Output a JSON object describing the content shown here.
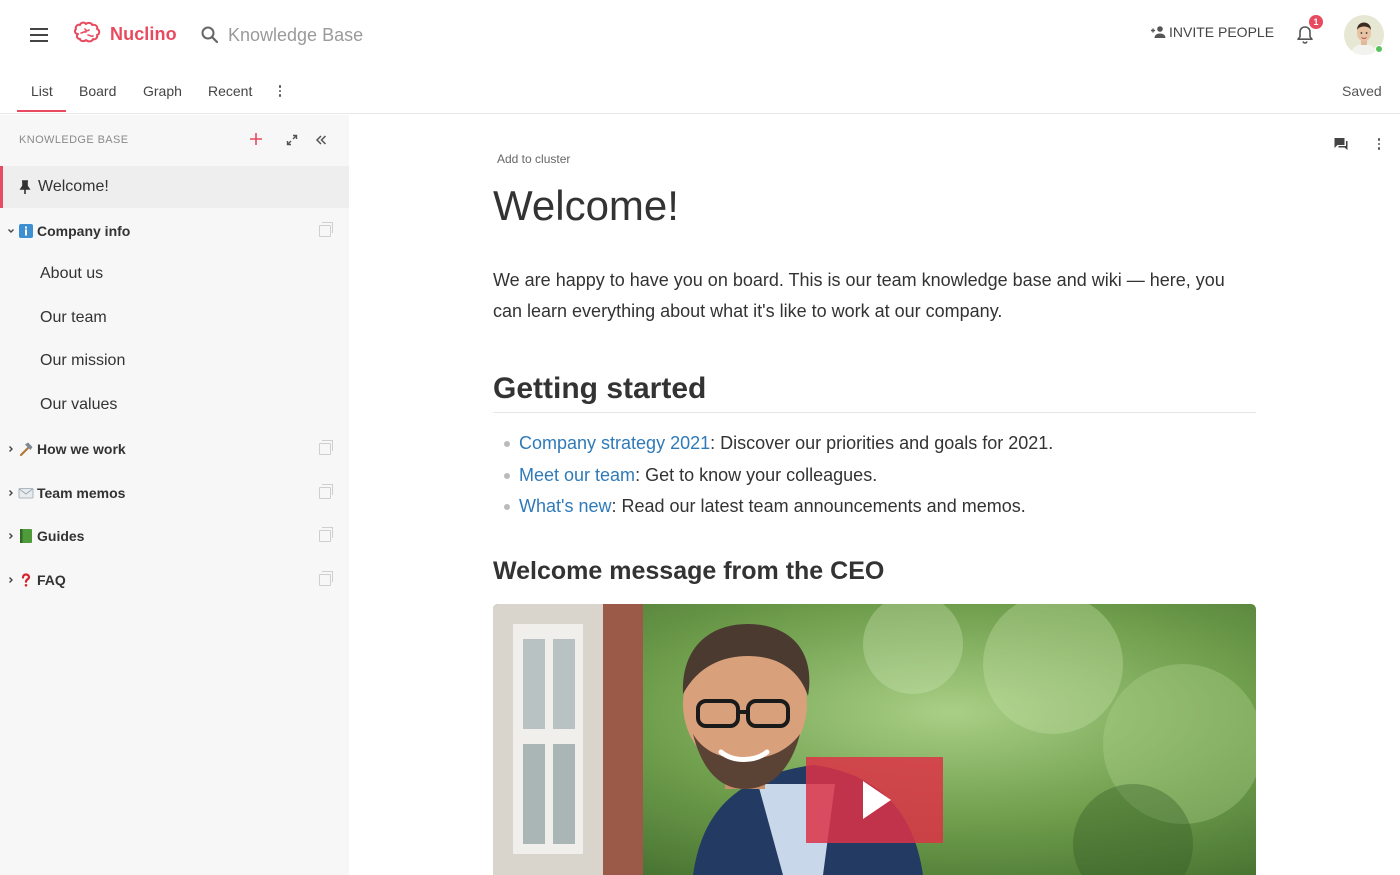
{
  "app": {
    "brand": "Nuclino",
    "search_placeholder": "Knowledge Base",
    "invite_label": "INVITE PEOPLE",
    "notification_count": "1",
    "save_status": "Saved",
    "accent_color": "#e84a5f",
    "link_color": "#2f7ab9"
  },
  "tabs": [
    {
      "label": "List",
      "active": true
    },
    {
      "label": "Board"
    },
    {
      "label": "Graph"
    },
    {
      "label": "Recent"
    }
  ],
  "sidebar": {
    "header": "KNOWLEDGE BASE",
    "items": [
      {
        "label": "Welcome!",
        "icon": "pin-icon",
        "active": true
      },
      {
        "label": "Company info",
        "icon": "info-icon",
        "expanded": true
      },
      {
        "label": "About us"
      },
      {
        "label": "Our team"
      },
      {
        "label": "Our mission"
      },
      {
        "label": "Our values"
      },
      {
        "label": "How we work",
        "icon": "hammer-icon"
      },
      {
        "label": "Team memos",
        "icon": "envelope-icon"
      },
      {
        "label": "Guides",
        "icon": "book-icon"
      },
      {
        "label": "FAQ",
        "icon": "question-icon"
      }
    ]
  },
  "doc": {
    "add_to_cluster": "Add to cluster",
    "title": "Welcome!",
    "intro": "We are happy to have you on board. This is our team knowledge base and wiki — here, you can learn everything about what it's like to work at our company.",
    "section_heading": "Getting started",
    "bullets": [
      {
        "link": "Company strategy 2021",
        "text": ": Discover our priorities and goals for 2021."
      },
      {
        "link": "Meet our team",
        "text": ": Get to know your colleagues."
      },
      {
        "link": "What's new",
        "text": ": Read our latest team announcements and memos."
      }
    ],
    "subsection_heading": "Welcome message from the CEO"
  }
}
